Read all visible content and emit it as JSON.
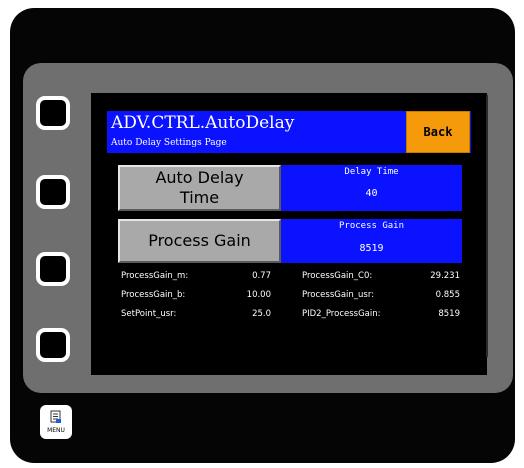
{
  "header": {
    "title": "ADV.CTRL.AutoDelay",
    "subtitle": "Auto Delay Settings Page",
    "back_label": "Back"
  },
  "controls": {
    "auto_delay_button": [
      "Auto Delay",
      "Time"
    ],
    "process_gain_button": "Process Gain",
    "delay_time": {
      "label": "Delay Time",
      "value": "40"
    },
    "process_gain": {
      "label": "Process Gain",
      "value": "8519"
    }
  },
  "params": {
    "left": [
      {
        "label": "ProcessGain_m:",
        "value": "0.77"
      },
      {
        "label": "ProcessGain_b:",
        "value": "10.00"
      },
      {
        "label": "SetPoint_usr:",
        "value": "25.0"
      }
    ],
    "right": [
      {
        "label": "ProcessGain_C0:",
        "value": "29.231"
      },
      {
        "label": "ProcessGain_usr:",
        "value": "0.855"
      },
      {
        "label": "PID2_ProcessGain:",
        "value": "8519"
      }
    ]
  },
  "menu": {
    "label": "MENU",
    "icon": "menu-icon"
  },
  "colors": {
    "title_bar": "#0a12ff",
    "back_button": "#f59a0a",
    "gray_button": "#a9a9a9"
  }
}
